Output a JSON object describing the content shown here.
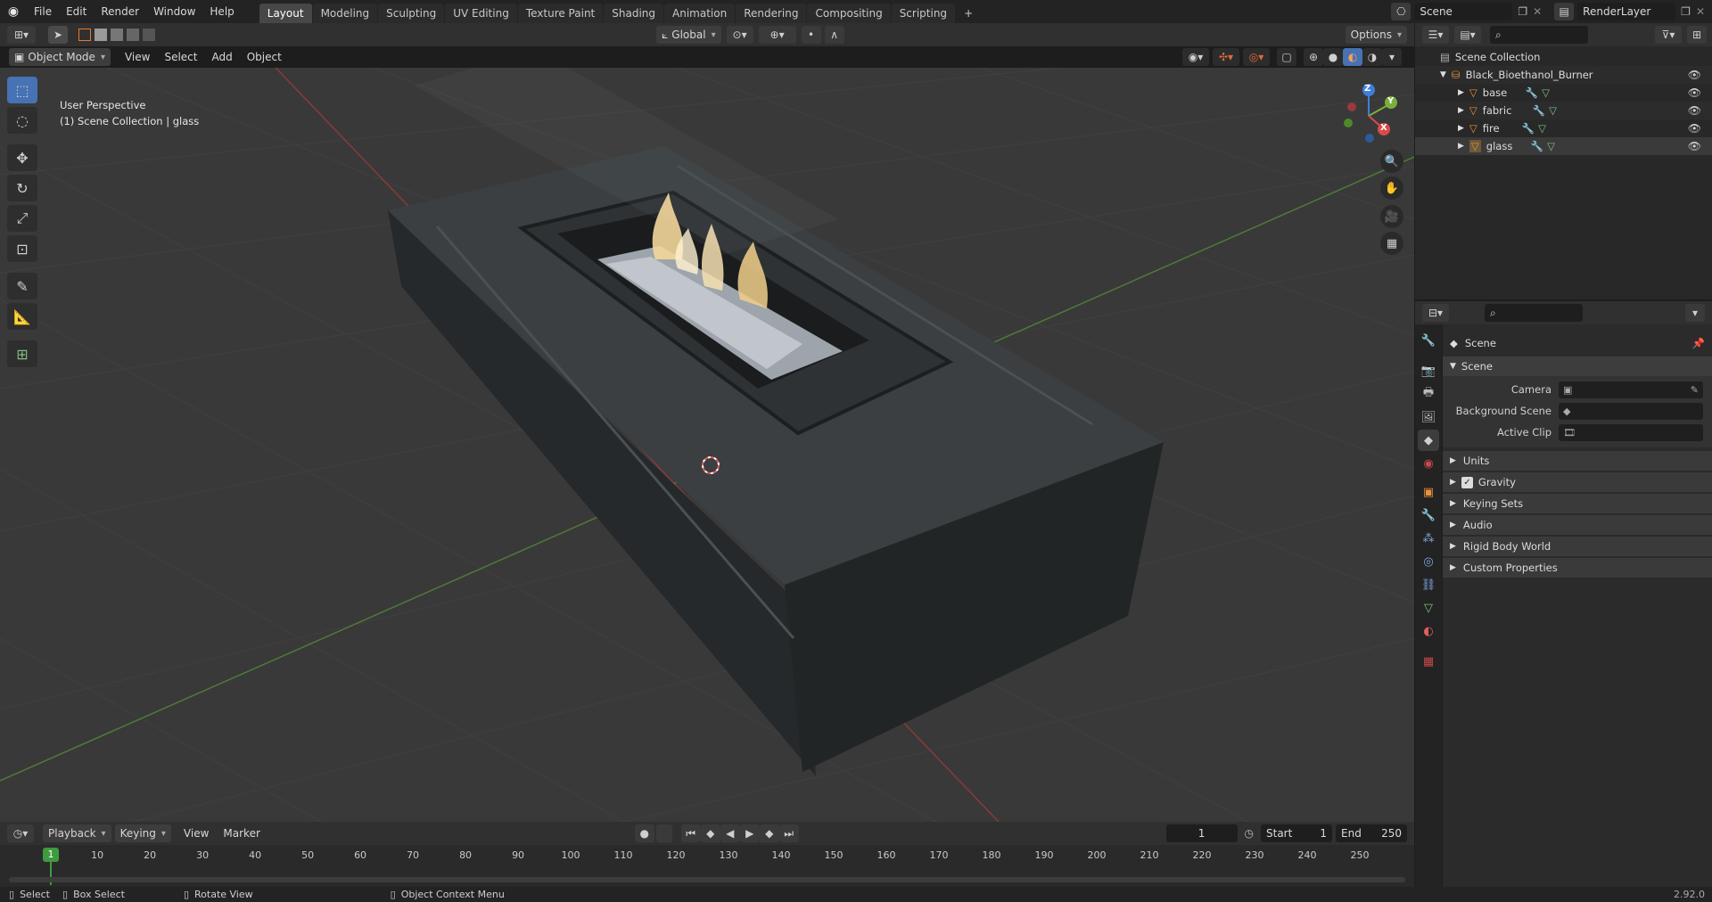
{
  "topbar": {
    "menus": [
      "File",
      "Edit",
      "Render",
      "Window",
      "Help"
    ],
    "workspaces": [
      "Layout",
      "Modeling",
      "Sculpting",
      "UV Editing",
      "Texture Paint",
      "Shading",
      "Animation",
      "Rendering",
      "Compositing",
      "Scripting"
    ],
    "active_workspace": "Layout",
    "scene_name": "Scene",
    "render_layer": "RenderLayer"
  },
  "viewport_header": {
    "mode": "Object Mode",
    "menus": [
      "View",
      "Select",
      "Add",
      "Object"
    ],
    "orientation": "Global",
    "options_label": "Options"
  },
  "viewport": {
    "perspective_label": "User Perspective",
    "collection_label": "(1) Scene Collection | glass",
    "gizmo_axes": [
      "X",
      "Y",
      "Z"
    ]
  },
  "outliner": {
    "root": "Scene Collection",
    "collection": "Black_Bioethanol_Burner",
    "objects": [
      "base",
      "fabric",
      "fire",
      "glass"
    ]
  },
  "properties": {
    "context": "Scene",
    "panel_title": "Scene",
    "fields": [
      {
        "label": "Camera",
        "value": ""
      },
      {
        "label": "Background Scene",
        "value": ""
      },
      {
        "label": "Active Clip",
        "value": ""
      }
    ],
    "subpanels": [
      "Units",
      "Gravity",
      "Keying Sets",
      "Audio",
      "Rigid Body World",
      "Custom Properties"
    ],
    "gravity_checked": true
  },
  "timeline": {
    "menus": [
      "Playback",
      "Keying",
      "View",
      "Marker"
    ],
    "current_frame": "1",
    "start_label": "Start",
    "start": "1",
    "end_label": "End",
    "end": "250",
    "ticks": [
      "10",
      "20",
      "30",
      "40",
      "50",
      "60",
      "70",
      "80",
      "90",
      "100",
      "110",
      "120",
      "130",
      "140",
      "150",
      "160",
      "170",
      "180",
      "190",
      "200",
      "210",
      "220",
      "230",
      "240",
      "250"
    ]
  },
  "statusbar": {
    "items": [
      "Select",
      "Box Select",
      "Rotate View",
      "Object Context Menu"
    ],
    "version": "2.92.0"
  },
  "colors": {
    "accent": "#4772b3",
    "object_orange": "#e8923a",
    "axis_x": "#d94b4b",
    "axis_y": "#7aaf3c",
    "axis_z": "#3f7fd9",
    "frame_green": "#3e9b3e"
  }
}
